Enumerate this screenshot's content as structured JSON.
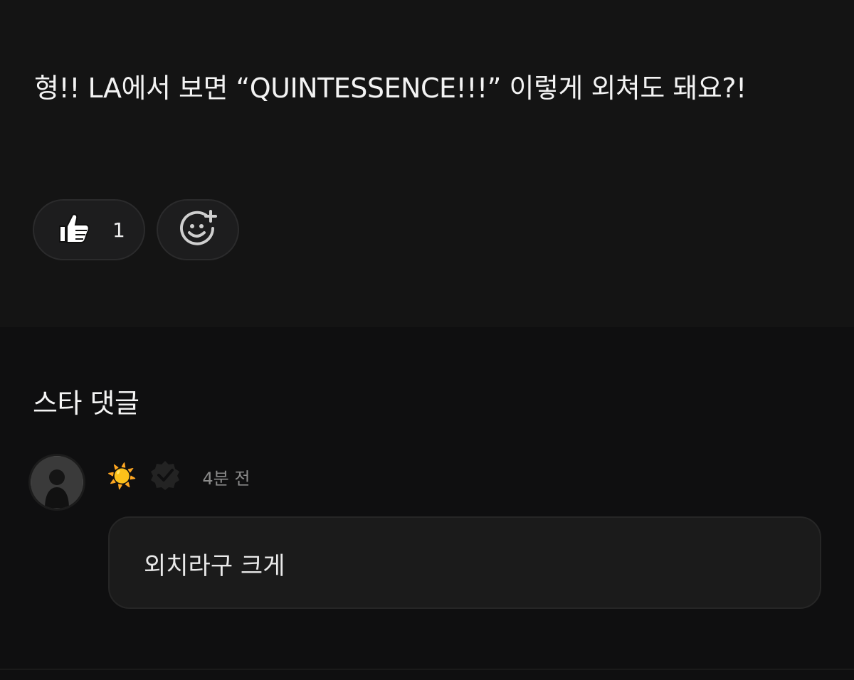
{
  "post": {
    "text": "형!! LA에서 보면 “QUINTESSENCE!!!” 이렇게 외쳐도 돼요?!"
  },
  "reactions": {
    "like_icon": "thumbs-up-icon",
    "like_count": "1",
    "add_icon": "add-reaction-icon"
  },
  "comments": {
    "section_title": "스타 댓글",
    "items": [
      {
        "nickname": "☀️",
        "verified_icon": "verified-badge-icon",
        "time": "4분 전",
        "text": "외치라구 크게"
      }
    ]
  }
}
